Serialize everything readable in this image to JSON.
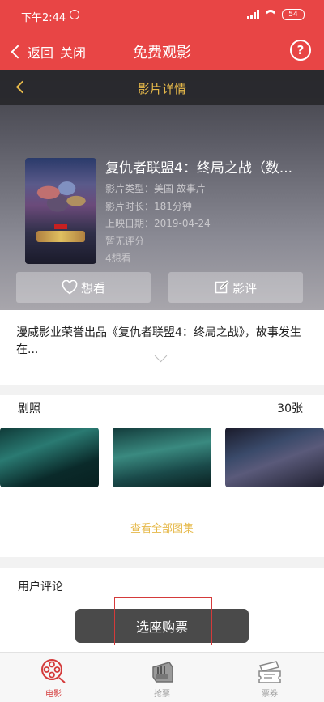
{
  "status_bar": {
    "time": "下午2:44",
    "battery": "54"
  },
  "app_bar": {
    "back_label": "返回",
    "close_label": "关闭",
    "title": "免费观影",
    "help_symbol": "?"
  },
  "detail_bar": {
    "title": "影片详情"
  },
  "movie": {
    "title": "复仇者联盟4：终局之战（数...",
    "type": "影片类型：美国 故事片",
    "duration": "影片时长：181分钟",
    "release_date": "上映日期：2019-04-24",
    "rating": "暂无评分",
    "want_count": "4想看",
    "poster_icon": "movie-poster"
  },
  "actions": {
    "want_label": "想看",
    "review_label": "影评"
  },
  "description": {
    "text": "漫威影业荣誉出品《复仇者联盟4：终局之战》，故事发生在..."
  },
  "stills": {
    "header": "剧照",
    "count": "30张",
    "view_all": "查看全部图集"
  },
  "comments": {
    "title": "用户评论"
  },
  "buy_button": {
    "label": "选座购票"
  },
  "tabs": [
    {
      "label": "电影",
      "icon": "film-reel-icon"
    },
    {
      "label": "抢票",
      "icon": "ticket-grab-icon"
    },
    {
      "label": "票券",
      "icon": "ticket-stack-icon"
    }
  ],
  "colors": {
    "brand_red": "#e84545",
    "gold": "#e6b94a",
    "active_tab": "#d43a3a"
  }
}
